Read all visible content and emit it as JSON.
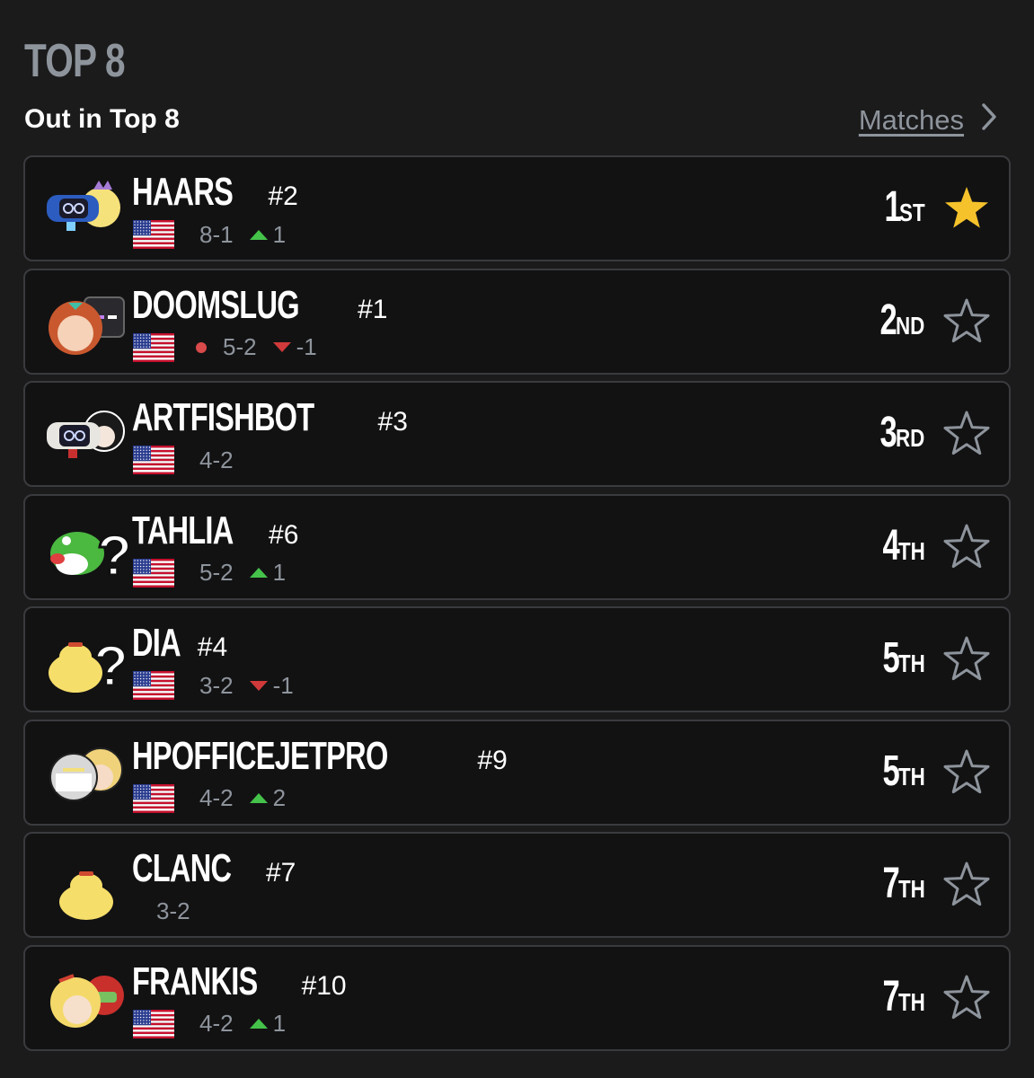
{
  "header": {
    "section_title": "TOP 8",
    "subtitle": "Out in Top 8",
    "matches_link": "Matches"
  },
  "colors": {
    "background": "#1b1b1c",
    "card": "#121213",
    "card_border": "#3a3b3e",
    "muted": "#8e949c",
    "up": "#45c24a",
    "down": "#d03a3a",
    "star_active": "#f5c22b"
  },
  "players": [
    {
      "tag": "HAARS",
      "seed": "#2",
      "flag": "us-flag",
      "record": "8-1",
      "change_dir": "up",
      "change": "1",
      "placement_num": "1",
      "placement_suffix": "ST",
      "favorite": true,
      "dot": false,
      "avatar": "robot-peach-icon"
    },
    {
      "tag": "DOOMSLUG",
      "seed": "#1",
      "flag": "us-flag",
      "record": "5-2",
      "change_dir": "down",
      "change": "-1",
      "placement_num": "2",
      "placement_suffix": "ND",
      "favorite": false,
      "dot": true,
      "avatar": "pyra-steve-icon"
    },
    {
      "tag": "ARTFISHBOT",
      "seed": "#3",
      "flag": "us-flag",
      "record": "4-2",
      "change_dir": "none",
      "change": "",
      "placement_num": "3",
      "placement_suffix": "RD",
      "favorite": false,
      "dot": false,
      "avatar": "robot-joker-icon"
    },
    {
      "tag": "TAHLIA",
      "seed": "#6",
      "flag": "us-flag",
      "record": "5-2",
      "change_dir": "up",
      "change": "1",
      "placement_num": "4",
      "placement_suffix": "TH",
      "favorite": false,
      "dot": false,
      "avatar": "yoshi-random-icon"
    },
    {
      "tag": "DIA",
      "seed": "#4",
      "flag": "us-flag",
      "record": "3-2",
      "change_dir": "down",
      "change": "-1",
      "placement_num": "5",
      "placement_suffix": "TH",
      "favorite": false,
      "dot": false,
      "avatar": "isabelle-random-icon"
    },
    {
      "tag": "HPOFFICEJETPRO",
      "seed": "#9",
      "flag": "us-flag",
      "record": "4-2",
      "change_dir": "up",
      "change": "2",
      "placement_num": "5",
      "placement_suffix": "TH",
      "favorite": false,
      "dot": false,
      "avatar": "sheik-ken-icon"
    },
    {
      "tag": "CLANC",
      "seed": "#7",
      "flag": "",
      "record": "3-2",
      "change_dir": "none",
      "change": "",
      "placement_num": "7",
      "placement_suffix": "TH",
      "favorite": false,
      "dot": false,
      "avatar": "isabelle-icon"
    },
    {
      "tag": "FRANKIS",
      "seed": "#10",
      "flag": "us-flag",
      "record": "4-2",
      "change_dir": "up",
      "change": "1",
      "placement_num": "7",
      "placement_suffix": "TH",
      "favorite": false,
      "dot": false,
      "avatar": "zss-samus-icon"
    }
  ]
}
